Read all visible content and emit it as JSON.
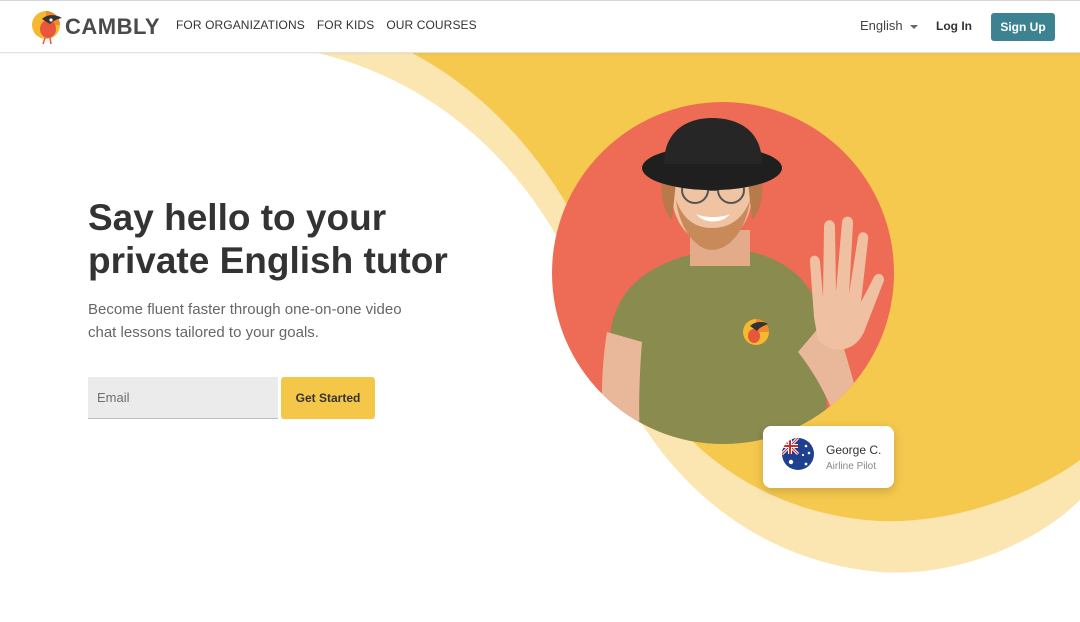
{
  "brand": {
    "name": "CAMBLY",
    "accent": "#f5c749",
    "teal": "#3c8290",
    "coral": "#ee6b56"
  },
  "nav": {
    "items": [
      {
        "label": "FOR ORGANIZATIONS"
      },
      {
        "label": "FOR KIDS"
      },
      {
        "label": "OUR COURSES"
      }
    ],
    "language": "English",
    "login": "Log In",
    "signup": "Sign Up"
  },
  "hero": {
    "title": "Say hello to your private English tutor",
    "subtitle": "Become fluent faster through one-on-one video chat lessons tailored to your goals.",
    "email_placeholder": "Email",
    "cta": "Get Started"
  },
  "tutor": {
    "name": "George C.",
    "role": "Airline Pilot",
    "flag_icon": "australia-flag-icon"
  }
}
